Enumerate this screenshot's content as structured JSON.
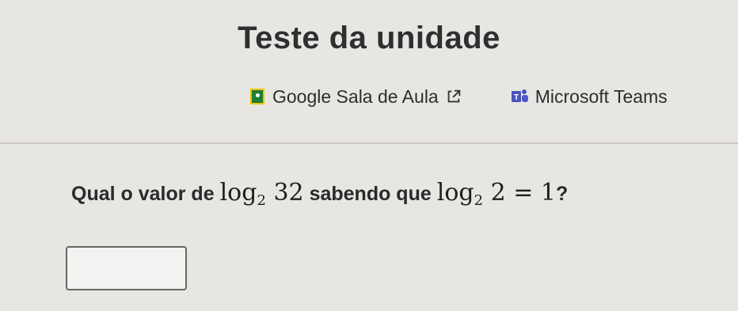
{
  "page": {
    "title": "Teste da unidade"
  },
  "share": {
    "classroom_label": "Google Sala de Aula",
    "teams_label": "Microsoft Teams",
    "classroom_icon": "google-classroom-icon",
    "external_icon": "external-link-icon",
    "teams_icon": "microsoft-teams-icon"
  },
  "question": {
    "prefix": "Qual o valor de ",
    "expr1_fn": "log",
    "expr1_base": "2",
    "expr1_arg": "32",
    "middle": " sabendo que ",
    "expr2_fn": "log",
    "expr2_base": "2",
    "expr2_rest": "2 = 1",
    "suffix": "?"
  },
  "answer": {
    "value": ""
  }
}
